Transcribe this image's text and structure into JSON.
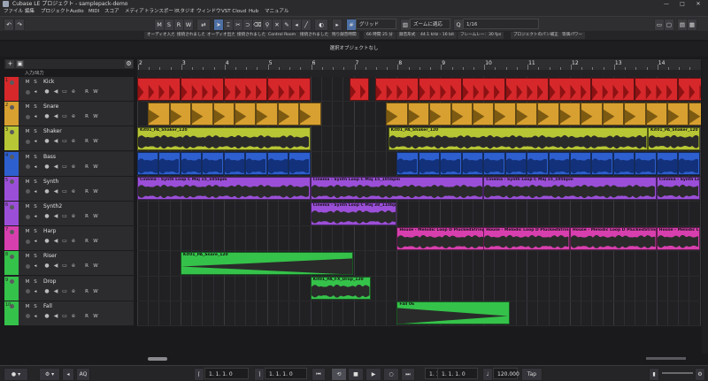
{
  "window": {
    "title": "Cubase LE プロジェクト - samplepack-demo",
    "controls": [
      "—",
      "□",
      "✕"
    ]
  },
  "menu": [
    "ファイル",
    "編集",
    "プロジェクト",
    "Audio",
    "MIDI",
    "スコア",
    "メディア",
    "トランスポート",
    "スタジオ",
    "ウィンドウ",
    "VST Cloud",
    "Hub",
    "マニュアル"
  ],
  "toolbar": {
    "undo_icon": "↶",
    "redo_icon": "↷",
    "msrw": [
      "M",
      "S",
      "R",
      "W"
    ],
    "snap_label": "グリッド",
    "zoom_label": "ズームに適応",
    "quantize_value": "1/16"
  },
  "info_line": [
    "オーディオ入力",
    "接続されました",
    "オーディオ出力",
    "接続されました",
    "Control Room",
    "接続されました",
    "残り録音時間",
    "66 時間 25 分",
    "録音形式",
    "44.1 kHz - 16 bit",
    "フレームレート",
    "30 fps",
    "プロジェクトのパン補正",
    "等価パワー"
  ],
  "status_text": "選択オブジェクトなし",
  "tracklist_header": {
    "add_icon": "+",
    "folder_icon": "▣",
    "input_label": "入力/出力"
  },
  "track_buttons": {
    "mute": "M",
    "solo": "S",
    "read": "R",
    "write": "W"
  },
  "tracks": [
    {
      "num": "1",
      "name": "Kick",
      "color": "#d6282b"
    },
    {
      "num": "2",
      "name": "Snare",
      "color": "#d8a030"
    },
    {
      "num": "3",
      "name": "Shaker",
      "color": "#b7c634"
    },
    {
      "num": "4",
      "name": "Bass",
      "color": "#2e5fcf"
    },
    {
      "num": "5",
      "name": "Synth",
      "color": "#9b4fd8"
    },
    {
      "num": "6",
      "name": "Synth2",
      "color": "#9b4fd8"
    },
    {
      "num": "7",
      "name": "Harp",
      "color": "#d83fae"
    },
    {
      "num": "8",
      "name": "Riser",
      "color": "#35c24a"
    },
    {
      "num": "9",
      "name": "Drop",
      "color": "#35c24a"
    },
    {
      "num": "10",
      "name": "Fall",
      "color": "#35c24a"
    }
  ],
  "ruler_bars": [
    "2",
    "3",
    "4",
    "5",
    "6",
    "7",
    "8",
    "9",
    "10",
    "11",
    "12",
    "13",
    "14"
  ],
  "events": {
    "shaker": "Kit01_PA_Shaker_120",
    "synth_a": "Cinema - Synth Loop C Maj 15_105bpm",
    "synth_b": "Cinema - Synth Loop C Maj 15_105bpm",
    "synth_c": "Cinema - Synth Loop C Maj 15_105bpm",
    "synth2": "Cinema - Synth Loop C Maj 38_110bpm",
    "harp": "House - Melodic Loop D PluckedStrings",
    "riser": "Kit01_PA_Snare_120",
    "drop": "Kit01_PA_FX_Drop_120",
    "fall": "Fall 06"
  },
  "transport": {
    "left_locator": "1. 1. 1.  0",
    "right_locator": "1. 1. 1.  0",
    "primary_position": "1. 1. 1.  0",
    "secondary_position": "1. 1. 1.  0",
    "tempo": "120.000",
    "tap_label": "Tap",
    "aq_label": "AQ"
  }
}
